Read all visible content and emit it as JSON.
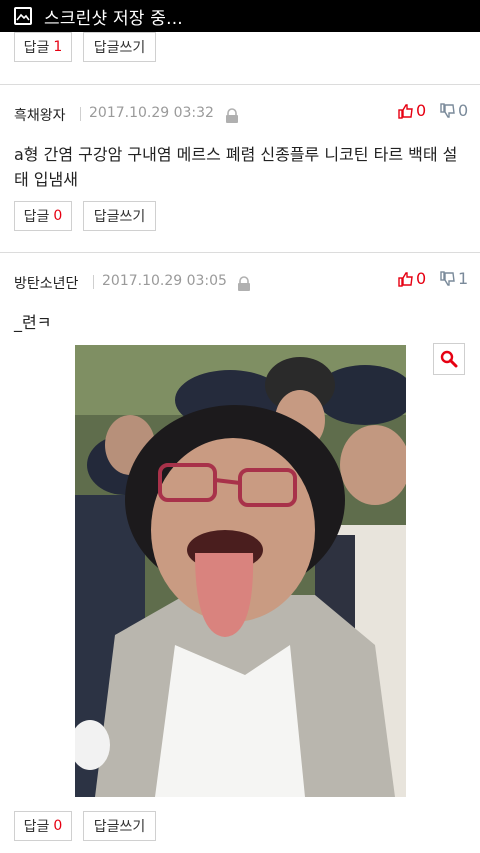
{
  "status_bar": {
    "text": "스크린샷 저장 중...",
    "icon": "image-icon"
  },
  "colors": {
    "accent": "#e60012",
    "border": "#d0d0d0",
    "muted": "#9a9a9a"
  },
  "top_actions": {
    "reply_label": "답글",
    "reply_count": "1",
    "write_label": "답글쓰기"
  },
  "comments": [
    {
      "author": "흑채왕자",
      "date": "2017.10.29 03:32",
      "upvotes": "0",
      "downvotes": "0",
      "text": "a형 간염 구강암 구내염 메르스 폐렴 신종플루 니코틴 타르 백태 설태 입냄새",
      "reply_label": "답글",
      "reply_count": "0",
      "write_label": "답글쓰기"
    },
    {
      "author": "방탄소년단",
      "date": "2017.10.29 03:05",
      "upvotes": "0",
      "downvotes": "1",
      "text": "_련ㅋ",
      "reply_label": "답글",
      "reply_count": "0",
      "write_label": "답글쓰기",
      "image": "photo of woman sticking out tongue among police officers"
    }
  ]
}
